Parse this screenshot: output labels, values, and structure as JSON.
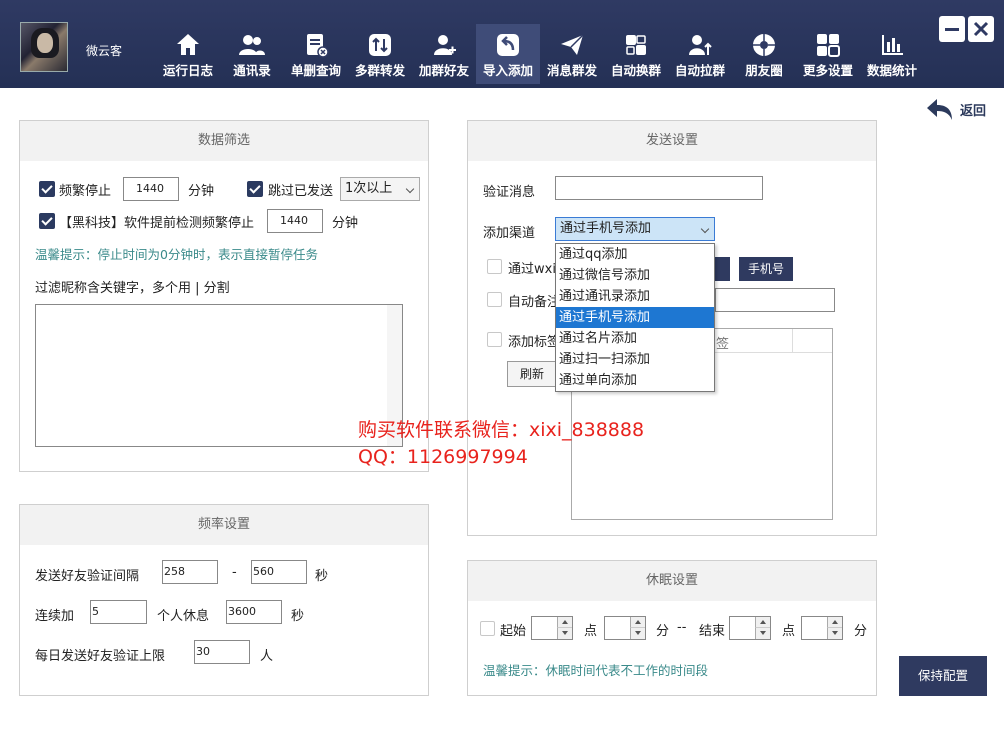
{
  "header": {
    "username": "微云客"
  },
  "nav": [
    {
      "label": "运行日志",
      "icon": "home-icon"
    },
    {
      "label": "通讯录",
      "icon": "contacts-icon"
    },
    {
      "label": "单删查询",
      "icon": "delete-query-icon"
    },
    {
      "label": "多群转发",
      "icon": "forward-icon"
    },
    {
      "label": "加群好友",
      "icon": "add-friend-icon"
    },
    {
      "label": "导入添加",
      "icon": "import-icon"
    },
    {
      "label": "消息群发",
      "icon": "send-icon"
    },
    {
      "label": "自动换群",
      "icon": "switch-group-icon"
    },
    {
      "label": "自动拉群",
      "icon": "pull-group-icon"
    },
    {
      "label": "朋友圈",
      "icon": "moments-icon"
    },
    {
      "label": "更多设置",
      "icon": "more-settings-icon"
    },
    {
      "label": "数据统计",
      "icon": "stats-icon"
    }
  ],
  "back_label": "返回",
  "filter": {
    "title": "数据筛选",
    "freq_stop_label": "频繁停止",
    "freq_stop_value": "1440",
    "minutes": "分钟",
    "skip_sent_label": "跳过已发送",
    "skip_sent_select": "1次以上",
    "blacktech_label": "【黑科技】软件提前检测频繁停止",
    "blacktech_value": "1440",
    "hint": "温馨提示：停止时间为0分钟时，表示直接暂停任务",
    "keyword_label": "过滤昵称含关键字，多个用 | 分割"
  },
  "rate": {
    "title": "频率设置",
    "interval_label": "发送好友验证间隔",
    "interval_min": "258",
    "dash": "-",
    "interval_max": "560",
    "seconds": "秒",
    "continuous_label": "连续加",
    "continuous_value": "5",
    "rest_label": "个人休息",
    "rest_value": "3600",
    "rest_unit": "秒",
    "daily_label": "每日发送好友验证上限",
    "daily_value": "30",
    "daily_unit": "人"
  },
  "send": {
    "title": "发送设置",
    "verify_label": "验证消息",
    "verify_value": "",
    "channel_label": "添加渠道",
    "channel_selected": "通过手机号添加",
    "channel_options": [
      "通过qq添加",
      "通过微信号添加",
      "通过通讯录添加",
      "通过手机号添加",
      "通过名片添加",
      "通过扫一扫添加",
      "通过单向添加"
    ],
    "via_wx_label": "通过wxi",
    "phone_button": "手机号",
    "auto_remark_label": "自动备注",
    "add_tag_label": "添加标签",
    "tag_col": "签",
    "refresh_button": "刷新"
  },
  "sleep": {
    "title": "休眠设置",
    "start_label": "起始",
    "point": "点",
    "minute": "分",
    "dash": "--",
    "end_label": "结束",
    "hint": "温馨提示：休眠时间代表不工作的时间段"
  },
  "save_button": "保持配置",
  "watermark": {
    "line1": "购买软件联系微信：xixi_838888",
    "line2": "QQ：1126997994"
  }
}
